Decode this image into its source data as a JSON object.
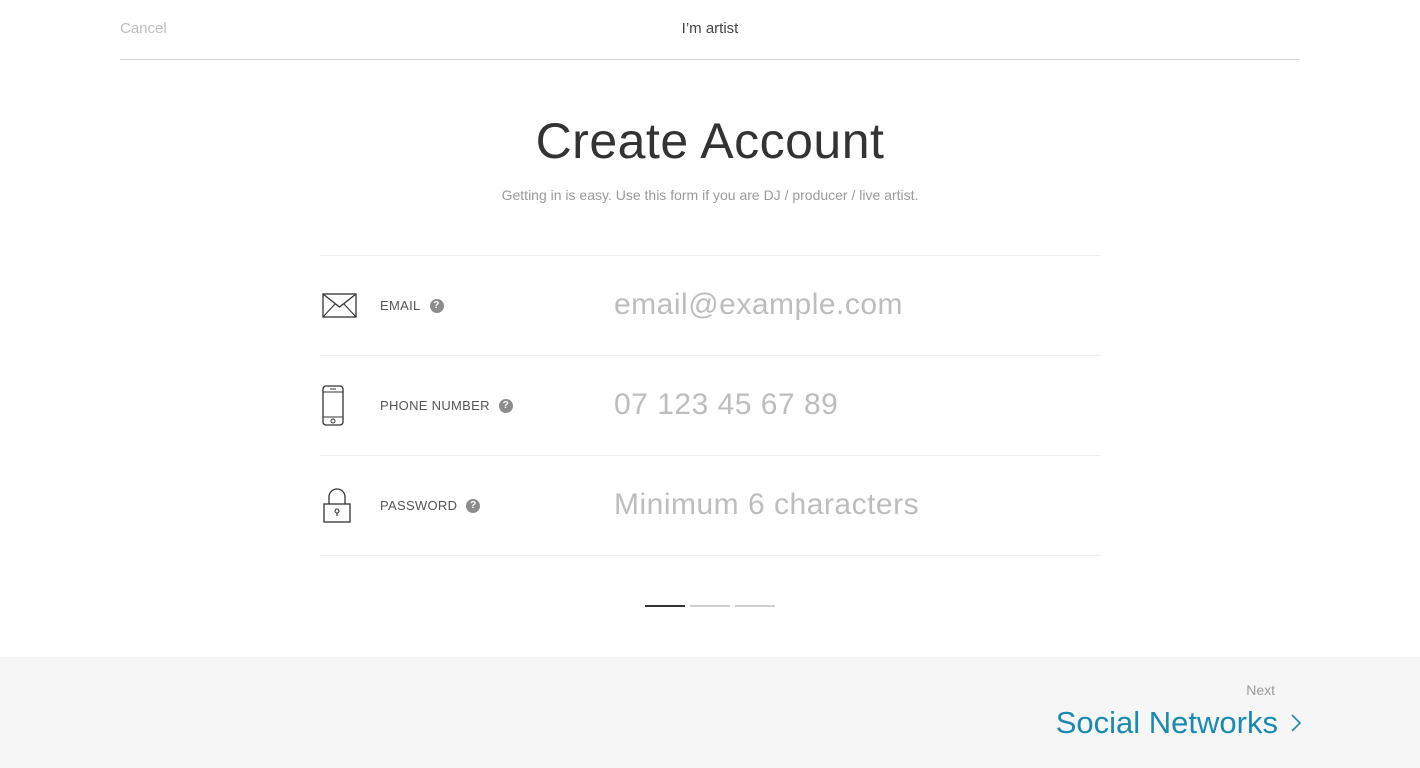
{
  "header": {
    "cancel_label": "Cancel",
    "title": "I’m artist"
  },
  "main": {
    "title": "Create Account",
    "subtitle": "Getting in is easy. Use this form if you are DJ / producer / live artist."
  },
  "form": {
    "fields": [
      {
        "label": "EMAIL",
        "icon": "envelope-icon",
        "help_icon": "question-circle-icon",
        "placeholder": "email@example.com",
        "value": ""
      },
      {
        "label": "PHONE NUMBER",
        "icon": "smartphone-icon",
        "help_icon": "question-circle-icon",
        "placeholder": "07 123 45 67 89",
        "value": ""
      },
      {
        "label": "PASSWORD",
        "icon": "padlock-icon",
        "help_icon": "question-circle-icon",
        "placeholder": "Minimum 6 characters",
        "value": ""
      }
    ],
    "help_glyph": "?"
  },
  "steps": {
    "total": 3,
    "current": 1
  },
  "footer": {
    "next_caption": "Next",
    "next_label": "Social Networks"
  },
  "colors": {
    "accent": "#1a8ab0",
    "placeholder": "#bdbdbd",
    "footer_bg": "#f6f6f6"
  }
}
